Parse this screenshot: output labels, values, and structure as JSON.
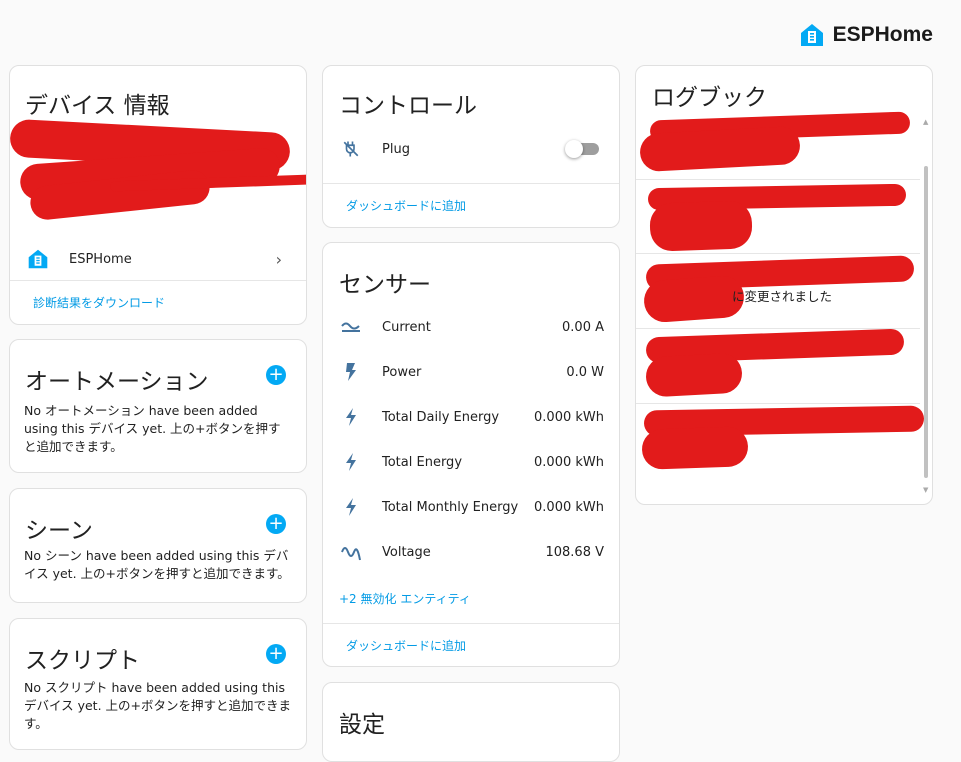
{
  "brand": {
    "name": "ESPHome",
    "color": "#03a9f4"
  },
  "device_info": {
    "title": "デバイス 情報",
    "integration_label": "ESPHome",
    "download_link": "診断結果をダウンロード"
  },
  "automations": {
    "title": "オートメーション",
    "description": "No オートメーション have been added using this デバイス yet. 上の+ボタンを押すと追加できます。"
  },
  "scenes": {
    "title": "シーン",
    "description": "No シーン have been added using this デバイス yet. 上の+ボタンを押すと追加できます。"
  },
  "scripts": {
    "title": "スクリプト",
    "description": "No スクリプト have been added using this デバイス yet. 上の+ボタンを押すと追加できます。"
  },
  "controls": {
    "title": "コントロール",
    "items": [
      {
        "name": "Plug",
        "icon": "power-plug-off-icon",
        "state": "off"
      }
    ],
    "add_to_dashboard": "ダッシュボードに追加"
  },
  "sensors": {
    "title": "センサー",
    "items": [
      {
        "name": "Current",
        "value": "0.00 A",
        "icon": "current-ac-icon"
      },
      {
        "name": "Power",
        "value": "0.0 W",
        "icon": "flash-icon"
      },
      {
        "name": "Total Daily Energy",
        "value": "0.000 kWh",
        "icon": "lightning-bolt-icon"
      },
      {
        "name": "Total Energy",
        "value": "0.000 kWh",
        "icon": "lightning-bolt-icon"
      },
      {
        "name": "Total Monthly Energy",
        "value": "0.000 kWh",
        "icon": "lightning-bolt-icon"
      },
      {
        "name": "Voltage",
        "value": "108.68 V",
        "icon": "sine-wave-icon"
      }
    ],
    "disabled_entities_link": "+2 無効化 エンティティ",
    "add_to_dashboard": "ダッシュボードに追加"
  },
  "settings": {
    "title": "設定"
  },
  "logbook": {
    "title": "ログブック",
    "entry_fragment": "に変更されました"
  }
}
